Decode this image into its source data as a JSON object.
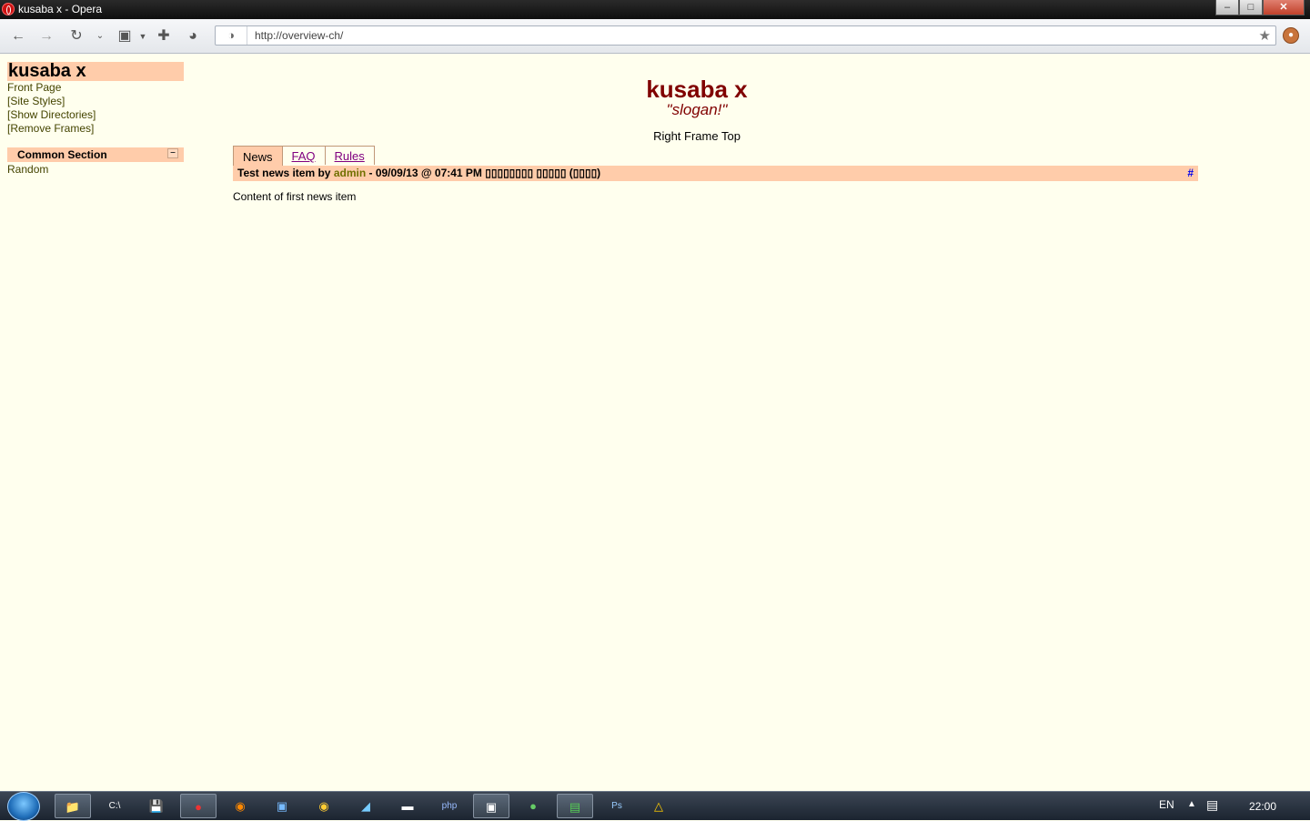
{
  "window": {
    "title": "kusaba x - Opera",
    "controls": [
      "–",
      "□",
      "✕"
    ]
  },
  "toolbar": {
    "url": "http://overview-ch/"
  },
  "left_frame": {
    "site_title": "kusaba x",
    "links": [
      "Front Page",
      "[Site Styles]",
      "[Show Directories]",
      "[Remove Frames]"
    ],
    "section": {
      "label": "Common Section",
      "toggle": "–",
      "items": [
        "Random"
      ]
    }
  },
  "right_frame": {
    "title": "kusaba x",
    "slogan": "\"slogan!\"",
    "frame_top": "Right Frame Top",
    "tabs": [
      "News",
      "FAQ",
      "Rules"
    ],
    "news": {
      "title_prefix": "Test news item by ",
      "author": "admin",
      "title_suffix": " - 09/09/13 @ 07:41 PM ▯▯▯▯▯▯▯▯ ▯▯▯▯▯ (▯▯▯▯)",
      "hash": "#",
      "content": "Content of first news item"
    }
  },
  "taskbar": {
    "language": "EN",
    "clock": "22:00",
    "apps": [
      "explorer-icon",
      "cmd-icon",
      "save-icon",
      "opera-icon",
      "firefox-icon",
      "window-icon",
      "chrome-icon",
      "tool-icon",
      "terminal-icon",
      "php-icon",
      "image-icon",
      "hs-icon",
      "colors-icon",
      "photoshop-icon",
      "warning-icon"
    ]
  }
}
